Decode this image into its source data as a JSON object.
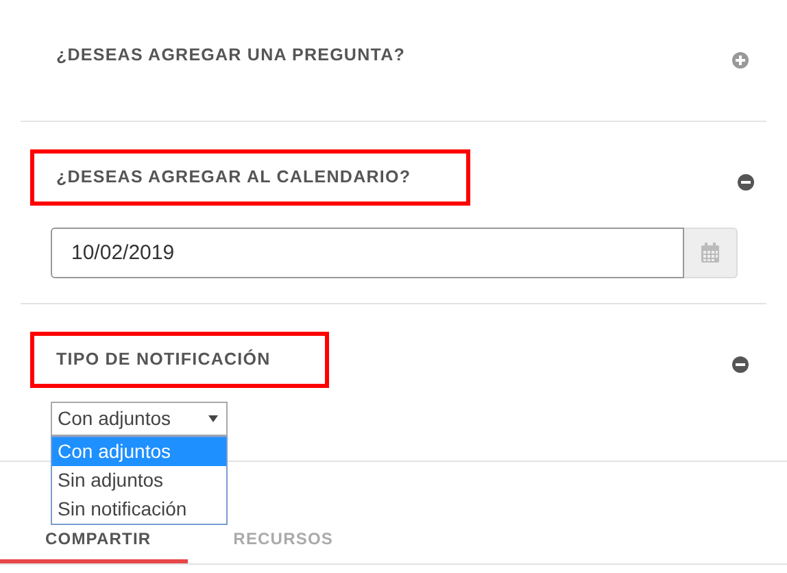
{
  "sections": [
    {
      "title": "¿DESEAS AGREGAR UNA PREGUNTA?",
      "expanded": false,
      "highlighted": false
    },
    {
      "title": "¿DESEAS AGREGAR AL CALENDARIO?",
      "expanded": true,
      "highlighted": true,
      "field": {
        "kind": "date",
        "value": "10/02/2019"
      }
    },
    {
      "title": "TIPO DE NOTIFICACIÓN",
      "expanded": true,
      "highlighted": true,
      "field": {
        "kind": "select",
        "value": "Con adjuntos",
        "open": true,
        "options": [
          {
            "label": "Con adjuntos",
            "selected": true
          },
          {
            "label": "Sin adjuntos",
            "selected": false
          },
          {
            "label": "Sin notificación",
            "selected": false
          }
        ]
      }
    }
  ],
  "tabs": [
    {
      "label": "COMPARTIR",
      "selected": true
    },
    {
      "label": "RECURSOS",
      "selected": false
    }
  ]
}
